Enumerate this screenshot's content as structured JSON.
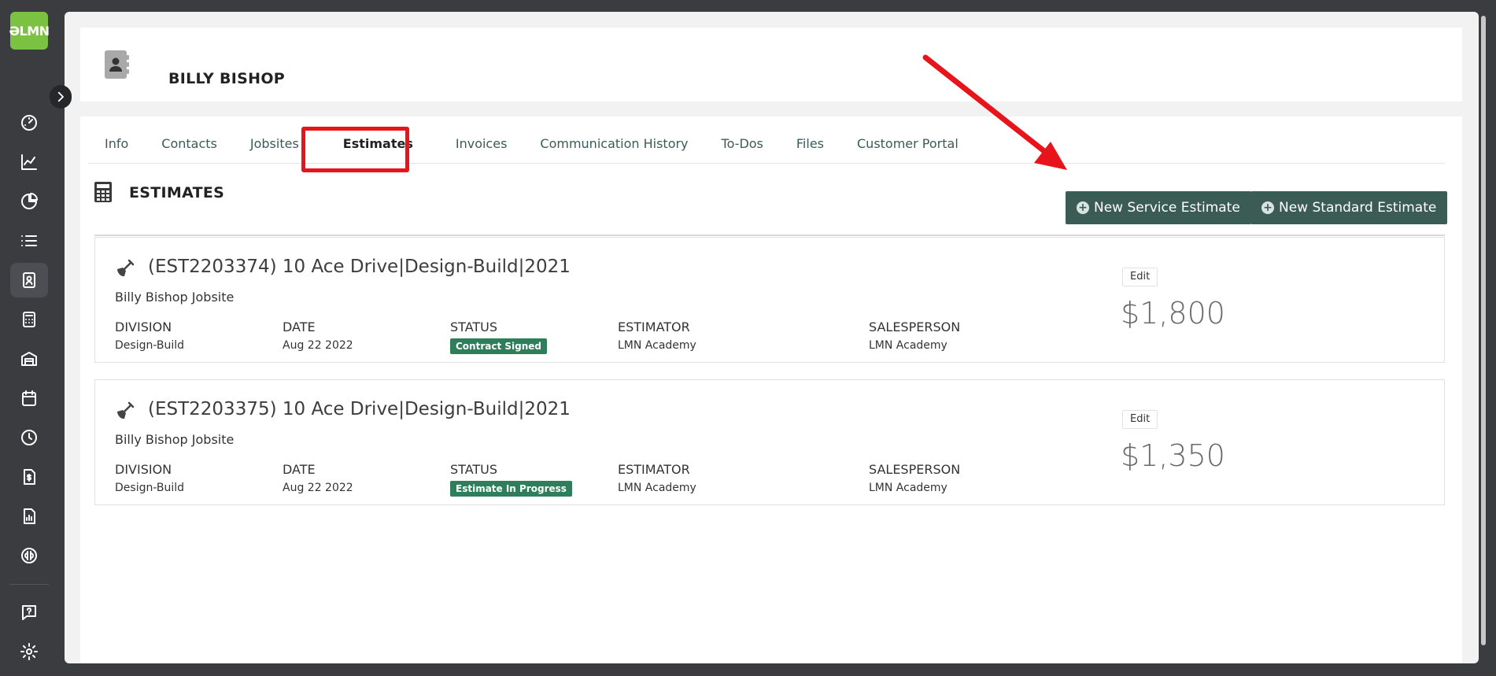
{
  "app": {
    "logo_text": "ƏLMN",
    "brand_color": "#7cc242"
  },
  "nav": [
    {
      "icon": "dashboard-icon"
    },
    {
      "icon": "chart-line-icon"
    },
    {
      "icon": "pie-chart-icon"
    },
    {
      "icon": "list-icon"
    },
    {
      "icon": "contact-card-icon",
      "active": true
    },
    {
      "icon": "calculator-icon"
    },
    {
      "icon": "warehouse-icon"
    },
    {
      "icon": "calendar-icon"
    },
    {
      "icon": "clock-icon"
    },
    {
      "icon": "invoice-icon"
    },
    {
      "icon": "report-icon"
    },
    {
      "icon": "quickbooks-icon"
    },
    {
      "icon": "help-icon"
    },
    {
      "icon": "settings-icon"
    }
  ],
  "header": {
    "title": "BILLY BISHOP"
  },
  "tabs": [
    {
      "label": "Info"
    },
    {
      "label": "Contacts"
    },
    {
      "label": "Jobsites"
    },
    {
      "label": "Estimates",
      "active": true
    },
    {
      "label": "Invoices"
    },
    {
      "label": "Communication History"
    },
    {
      "label": "To-Dos"
    },
    {
      "label": "Files"
    },
    {
      "label": "Customer Portal"
    }
  ],
  "section": {
    "title": "ESTIMATES",
    "new_service_label": "New Service Estimate",
    "new_standard_label": "New Standard Estimate"
  },
  "columns": {
    "division": "DIVISION",
    "date": "DATE",
    "status": "STATUS",
    "estimator": "ESTIMATOR",
    "salesperson": "SALESPERSON"
  },
  "estimates": [
    {
      "title": "(EST2203374) 10 Ace Drive|Design-Build|2021",
      "jobsite": "Billy Bishop Jobsite",
      "division": "Design-Build",
      "date": "Aug 22 2022",
      "status": "Contract Signed",
      "estimator": "LMN Academy",
      "salesperson": "LMN Academy",
      "edit_label": "Edit",
      "amount": "$1,800"
    },
    {
      "title": "(EST2203375) 10 Ace Drive|Design-Build|2021",
      "jobsite": "Billy Bishop Jobsite",
      "division": "Design-Build",
      "date": "Aug 22 2022",
      "status": "Estimate In Progress",
      "estimator": "LMN Academy",
      "salesperson": "LMN Academy",
      "edit_label": "Edit",
      "amount": "$1,350"
    }
  ],
  "colors": {
    "button_bg": "#3b5c55",
    "status_badge": "#2e7d5b",
    "annotation": "#e8141b"
  }
}
